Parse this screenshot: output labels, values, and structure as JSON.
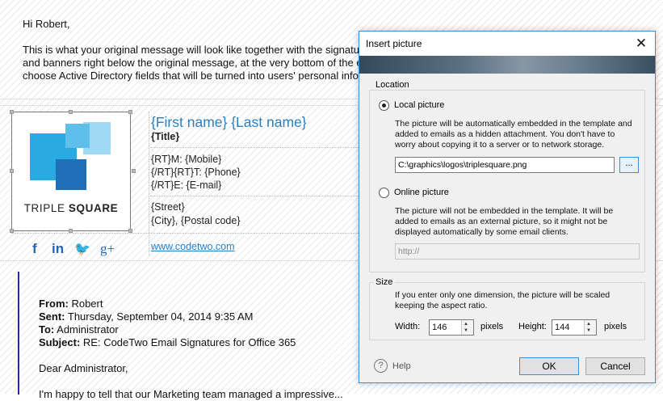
{
  "email": {
    "greeting": "Hi Robert,",
    "intro_lines": [
      "This is what your original message will look like together with the signatu",
      "and banners right below the original message, at the very bottom of the e",
      "choose Active Directory fields that will be turned into users' personal info"
    ]
  },
  "signature": {
    "logo_text_light": "TRIPLE ",
    "logo_text_bold": "SQUARE",
    "name_line": "{First name} {Last name}",
    "title_line": "{Title}",
    "contact_lines": [
      "{RT}M: {Mobile}",
      "{/RT}{RT}T: {Phone}",
      "{/RT}E: {E-mail}"
    ],
    "address_lines": [
      "{Street}",
      "{City}, {Postal code}"
    ],
    "social_icons": [
      "facebook-icon",
      "linkedin-icon",
      "twitter-icon",
      "google-plus-icon"
    ],
    "social_glyphs": [
      "f",
      "in",
      "🐦",
      "g+"
    ],
    "website": "www.codetwo.com"
  },
  "reply": {
    "from_label": "From:",
    "from_value": " Robert",
    "sent_label": "Sent:",
    "sent_value": " Thursday, September 04, 2014 9:35 AM",
    "to_label": "To:",
    "to_value": " Administrator",
    "subject_label": "Subject:",
    "subject_value": " RE: CodeTwo Email Signatures for Office 365",
    "dear": "Dear Administrator,",
    "cut_line": "I'm happy to tell that our Marketing team managed a impressive..."
  },
  "dialog": {
    "title": "Insert picture",
    "close_symbol": "✕",
    "location": {
      "label": "Location",
      "local": {
        "label": "Local picture",
        "selected": true,
        "description": [
          "The picture will be automatically embedded in the template and",
          "added to emails as a hidden attachment. You don't have to",
          "worry about copying it to a server or to network storage."
        ],
        "path": "C:\\graphics\\logos\\triplesquare.png",
        "browse_label": "..."
      },
      "online": {
        "label": "Online picture",
        "selected": false,
        "description": [
          "The picture will not be embedded in the template. It will be",
          "added to emails as an external picture, so it might not be",
          "displayed automatically by some email clients."
        ],
        "url_placeholder": "http://"
      }
    },
    "size": {
      "label": "Size",
      "description": [
        "If you enter only one dimension, the picture will be scaled",
        "keeping the aspect ratio."
      ],
      "width_label": "Width:",
      "width_value": "146",
      "height_label": "Height:",
      "height_value": "144",
      "unit": "pixels"
    },
    "help_label": "Help",
    "help_symbol": "?",
    "ok_label": "OK",
    "cancel_label": "Cancel"
  }
}
